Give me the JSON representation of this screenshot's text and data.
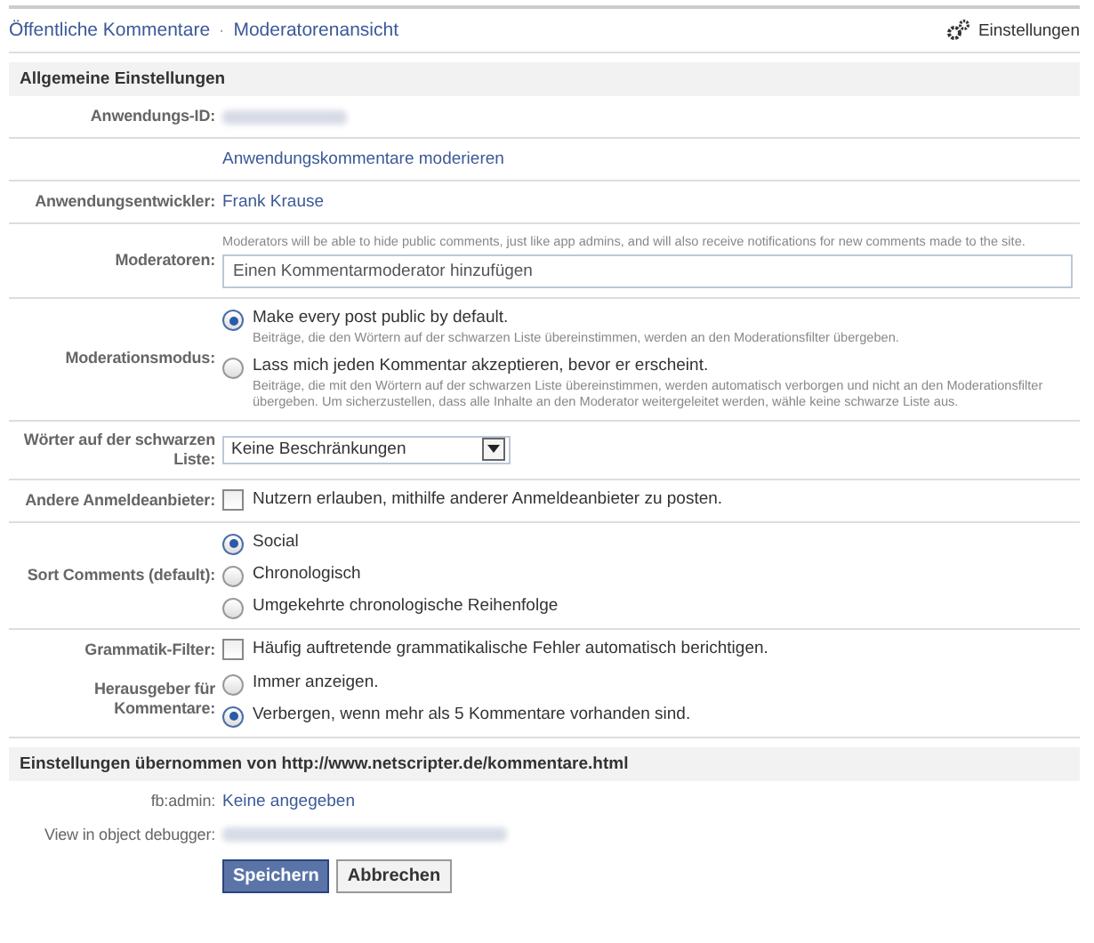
{
  "header": {
    "breadcrumb": [
      {
        "label": "Öffentliche Kommentare"
      },
      {
        "label": "Moderatorenansicht"
      }
    ],
    "separator": "·",
    "settings_link": "Einstellungen"
  },
  "sections": [
    {
      "title": "Allgemeine Einstellungen",
      "groups": [
        [
          {
            "kind": "redacted",
            "label": "Anwendungs-ID:"
          }
        ],
        [
          {
            "kind": "link",
            "value": "Anwendungskommentare moderieren"
          }
        ],
        [
          {
            "kind": "link",
            "label": "Anwendungsentwickler:",
            "value": "Frank Krause"
          }
        ],
        [
          {
            "kind": "field",
            "label": "Moderatoren:",
            "hint": "Moderators will be able to hide public comments, just like app admins, and will also receive notifications for new comments made to the site.",
            "placeholder": "Einen Kommentarmoderator hinzufügen"
          }
        ],
        [
          {
            "kind": "radios",
            "label": "Moderationsmodus:",
            "options": [
              {
                "label": "Make every post public by default.",
                "description": "Beiträge, die den Wörtern auf der schwarzen Liste übereinstimmen, werden an den Moderationsfilter übergeben.",
                "selected": true
              },
              {
                "label": "Lass mich jeden Kommentar akzeptieren, bevor er erscheint.",
                "description": "Beiträge, die mit den Wörtern auf der schwarzen Liste übereinstimmen, werden automatisch verborgen und nicht an den Moderationsfilter übergeben. Um sicherzustellen, dass alle Inhalte an den Moderator weitergeleitet werden, wähle keine schwarze Liste aus.",
                "selected": false
              }
            ]
          }
        ],
        [
          {
            "kind": "select",
            "label": "Wörter auf der schwarzen Liste:",
            "value": "Keine Beschränkungen"
          }
        ],
        [
          {
            "kind": "checkbox",
            "label": "Andere Anmeldeanbieter:",
            "text": "Nutzern erlauben, mithilfe anderer Anmeldeanbieter zu posten.",
            "checked": false
          }
        ],
        [
          {
            "kind": "radios",
            "label": "Sort Comments (default):",
            "options": [
              {
                "label": "Social",
                "selected": true
              },
              {
                "label": "Chronologisch",
                "selected": false
              },
              {
                "label": "Umgekehrte chronologische Reihenfolge",
                "selected": false
              }
            ]
          }
        ],
        [
          {
            "kind": "checkbox",
            "label": "Grammatik-Filter:",
            "text": "Häufig auftretende grammatikalische Fehler automatisch berichtigen.",
            "checked": false
          },
          {
            "kind": "radios",
            "label": "Herausgeber für Kommentare:",
            "options": [
              {
                "label": "Immer anzeigen.",
                "selected": false
              },
              {
                "label": "Verbergen, wenn mehr als 5 Kommentare vorhanden sind.",
                "selected": true
              }
            ]
          }
        ]
      ]
    },
    {
      "title": "Einstellungen übernommen von http://www.netscripter.de/kommentare.html",
      "groups": [
        [
          {
            "kind": "link",
            "label": "fb:admin:",
            "value": "Keine angegeben"
          },
          {
            "kind": "redacted",
            "label": "View in object debugger:"
          }
        ]
      ]
    }
  ],
  "buttons": [
    {
      "label": "Speichern"
    },
    {
      "label": "Abbrechen"
    }
  ]
}
